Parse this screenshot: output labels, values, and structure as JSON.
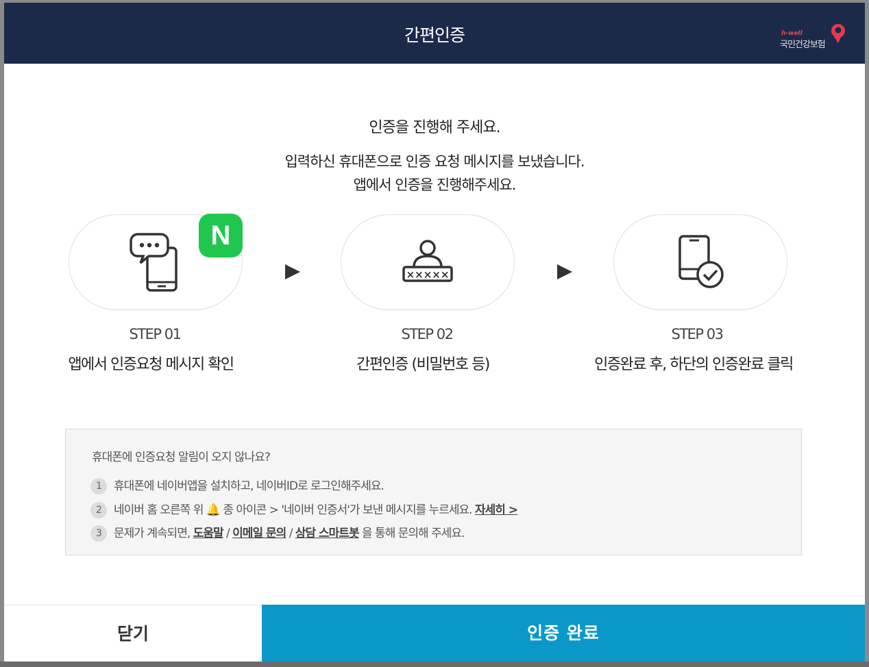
{
  "header": {
    "title": "간편인증",
    "logo_top": "h-well",
    "logo_name": "국민건강보험"
  },
  "intro": {
    "line1": "인증을 진행해 주세요.",
    "line2": "입력하신 휴대폰으로 인증 요청 메시지를 보냈습니다.",
    "line3": "앱에서 인증을 진행해주세요."
  },
  "steps": [
    {
      "num": "STEP 01",
      "desc": "앱에서 인증요청 메시지 확인",
      "icon": "phone-message-icon"
    },
    {
      "num": "STEP 02",
      "desc": "간편인증 (비밀번호 등)",
      "icon": "user-password-icon"
    },
    {
      "num": "STEP 03",
      "desc": "인증완료 후, 하단의 인증완료 클릭",
      "icon": "phone-check-icon"
    }
  ],
  "naver_badge": "N",
  "help": {
    "question": "휴대폰에 인증요청 알림이 오지 않나요?",
    "item1": {
      "num": "1",
      "text": "휴대폰에 네이버앱을 설치하고, 네이버ID로 로그인해주세요."
    },
    "item2": {
      "num": "2",
      "pre": "네이버 홈 오른쪽 위",
      "bell": "🔔",
      "post": "종 아이콘 > '네이버 인증서'가 보낸 메시지를 누르세요.",
      "link": "자세히 >"
    },
    "item3": {
      "num": "3",
      "pre": "문제가 계속되면,",
      "link1": "도움말",
      "sep1": "/",
      "link2": "이메일 문의",
      "sep2": "/",
      "link3": "상담 스마트봇",
      "post": "을 통해 문의해 주세요."
    }
  },
  "buttons": {
    "close": "닫기",
    "done": "인증 완료"
  },
  "colors": {
    "header": "#1c2a4a",
    "primary": "#0a98c9",
    "naver": "#1fc74f"
  }
}
